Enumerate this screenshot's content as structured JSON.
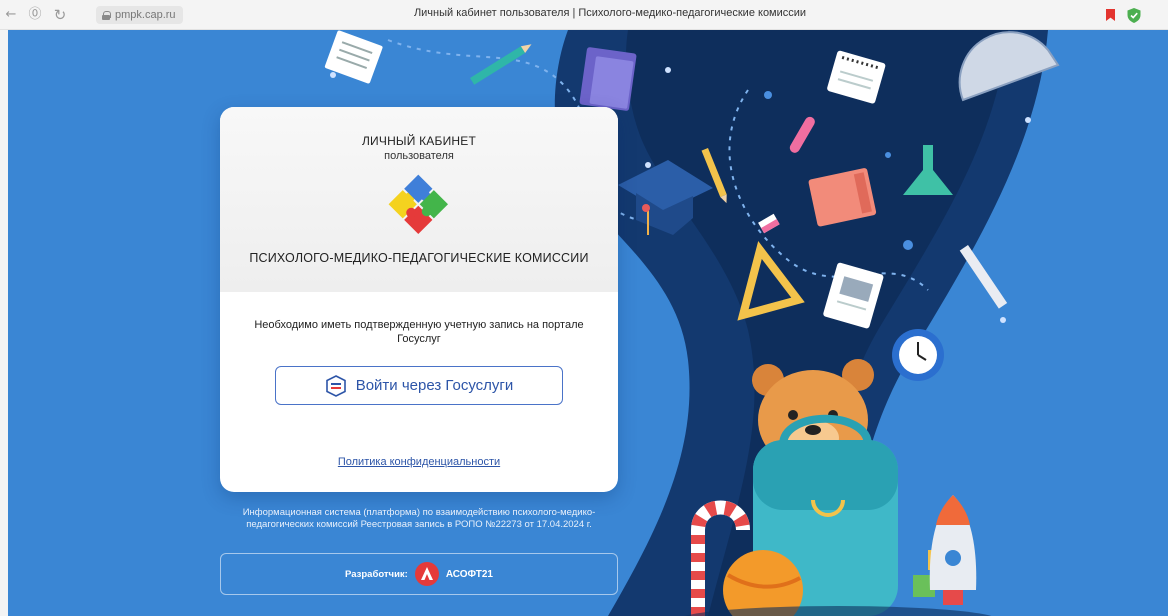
{
  "browser": {
    "back_icon": "←",
    "reader_icon": "⓪",
    "reload_icon": "↻",
    "url": "pmpk.cap.ru",
    "title": "Личный кабинет пользователя | Психолого-медико-педагогические комиссии"
  },
  "card": {
    "title": "ЛИЧНЫЙ КАБИНЕТ",
    "subtitle": "пользователя",
    "organization": "ПСИХОЛОГО-МЕДИКО-ПЕДАГОГИЧЕСКИЕ КОМИССИИ",
    "note": "Необходимо иметь подтвержденную учетную запись на портале Госуслуг",
    "login_button": "Войти через Госуслуги",
    "privacy_link": "Политика конфиденциальности"
  },
  "footer": {
    "info": "Информационная система (платформа) по взаимодействию психолого-медико-педагогических комиссий Реестровая запись в РОПО №22273 от 17.04.2024 г.",
    "developer_label": "Разработчик:",
    "developer_name": "АСОФТ21"
  },
  "colors": {
    "page_background": "#3a86d4",
    "accent": "#2d55a8",
    "bookmark": "#e3342f",
    "shield": "#4caf50"
  }
}
